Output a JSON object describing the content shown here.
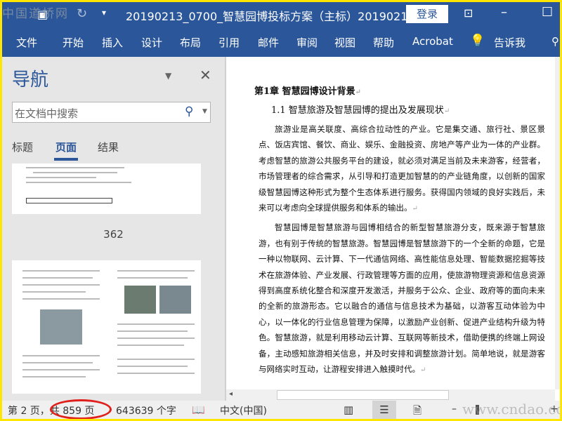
{
  "window": {
    "title": "20190213_0700_智慧园博投标方案（主标）2019021...",
    "login_label": "登录",
    "accent": "#2b579a"
  },
  "ribbon": {
    "tabs": [
      "文件",
      "开始",
      "插入",
      "设计",
      "布局",
      "引用",
      "邮件",
      "审阅",
      "视图",
      "帮助",
      "Acrobat"
    ],
    "tell_me": "告诉我"
  },
  "nav": {
    "title": "导航",
    "search_placeholder": "在文档中搜索",
    "tabs": [
      "标题",
      "页面",
      "结果"
    ],
    "active_tab": "页面",
    "page_label": "362"
  },
  "document": {
    "heading1": "第1章 智慧园博设计背景",
    "heading2": "1.1 智慧旅游及智慧园博的提出及发展现状",
    "paragraphs": [
      "旅游业是高关联度、高综合拉动性的产业。它是集交通、旅行社、景区景点、饭店宾馆、餐饮、商业、娱乐、金融投资、房地产等产业为一体的产业群。考虑智慧的旅游公共服务平台的建设，就必须对满足当前及未来游客，经营者，市场管理者的综合需求，从引导和打造更加智慧的的产业链角度，以创新的国家级智慧园博这种形式为整个生态体系进行服务。获得国内领域的良好实践后，未来可以考虑向全球提供服务和体系的输出。",
      "智慧园博是智慧旅游与园博相结合的新型智慧旅游分支，既来源于智慧旅游，也有别于传统的智慧旅游。智慧园博是智慧旅游下的一个全新的命题，它是一种以物联网、云计算、下一代通信网络、高性能信息处理、智能数据挖掘等技术在旅游体验、产业发展、行政管理等方面的应用，使旅游物理资源和信息资源得到高度系统化整合和深度开发激活，并服务于公众、企业、政府等的面向未来的全新的旅游形态。它以融合的通信与信息技术为基础，以游客互动体验为中心，以一体化的行业信息管理为保障，以激励产业创新、促进产业结构升级为特色。智慧旅游，就是利用移动云计算、互联网等新技术，借助便携的终端上网设备，主动感知旅游相关信息，并及时安排和调整旅游计划。简单地说，就是游客与网络实时互动，让游程安排进入触摸时代。"
    ]
  },
  "status": {
    "page": "第 2 页，共 859 页",
    "words": "643639 个字",
    "language": "中文(中国)",
    "highlight_color": "#e0201c"
  },
  "watermarks": {
    "top": "中国道桥网",
    "bottom": "www.cndao.com"
  }
}
